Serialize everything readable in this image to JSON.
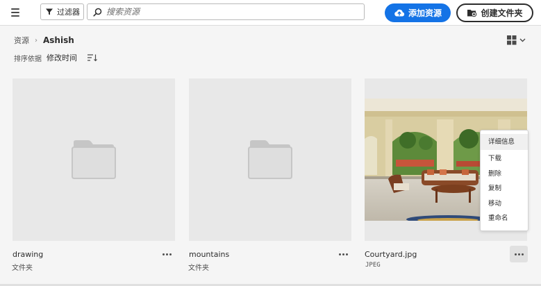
{
  "topbar": {
    "menu_icon": "hamburger-icon",
    "filter_label": "过滤器",
    "search_placeholder": "搜索资源",
    "add_asset_label": "添加资源",
    "create_folder_label": "创建文件夹"
  },
  "breadcrumb": {
    "root": "资源",
    "current": "Ashish"
  },
  "sort": {
    "label": "排序依据",
    "value": "修改时间"
  },
  "assets": [
    {
      "name": "drawing",
      "type": "文件夹",
      "icon": "folder-icon"
    },
    {
      "name": "mountains",
      "type": "文件夹",
      "icon": "folder-icon"
    },
    {
      "name": "Courtyard.jpg",
      "type": "JPEG",
      "icon": "image-thumbnail"
    }
  ],
  "context_menu": {
    "items": [
      "详细信息",
      "下载",
      "删除",
      "复制",
      "移动",
      "重命名"
    ]
  },
  "colors": {
    "accent": "#1473e6",
    "thumb_bg": "#e8e8e8",
    "page_bg": "#f5f5f5"
  }
}
